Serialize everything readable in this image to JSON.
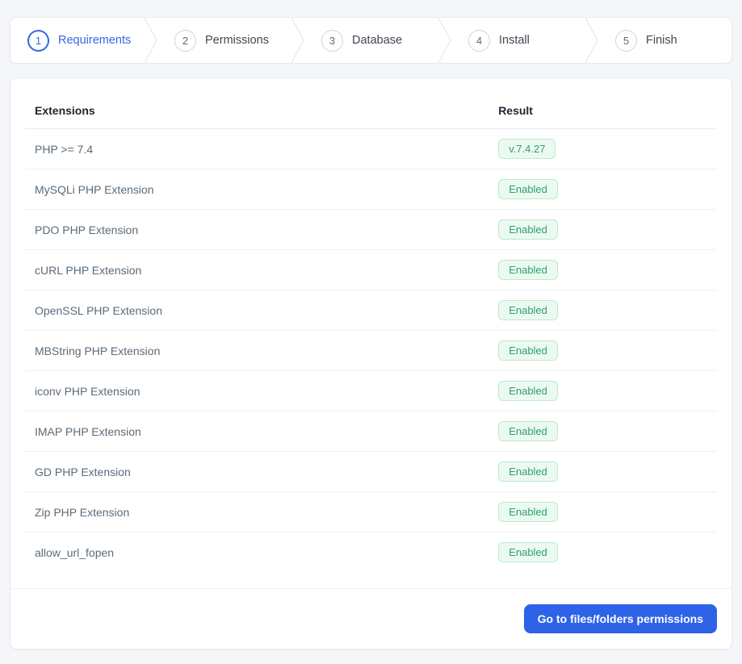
{
  "colors": {
    "accent": "#3566e3",
    "button_blue": "#2e63e8",
    "success_text": "#2f9e6e",
    "success_bg": "#eafaf1",
    "success_border": "#bfe9cd",
    "page_bg": "#f4f6f9"
  },
  "stepper": {
    "steps": [
      {
        "number": "1",
        "label": "Requirements",
        "active": true
      },
      {
        "number": "2",
        "label": "Permissions",
        "active": false
      },
      {
        "number": "3",
        "label": "Database",
        "active": false
      },
      {
        "number": "4",
        "label": "Install",
        "active": false
      },
      {
        "number": "5",
        "label": "Finish",
        "active": false
      }
    ]
  },
  "table": {
    "headers": {
      "extensions": "Extensions",
      "result": "Result"
    },
    "rows": [
      {
        "extension": "PHP >= 7.4",
        "result": "v.7.4.27"
      },
      {
        "extension": "MySQLi PHP Extension",
        "result": "Enabled"
      },
      {
        "extension": "PDO PHP Extension",
        "result": "Enabled"
      },
      {
        "extension": "cURL PHP Extension",
        "result": "Enabled"
      },
      {
        "extension": "OpenSSL PHP Extension",
        "result": "Enabled"
      },
      {
        "extension": "MBString PHP Extension",
        "result": "Enabled"
      },
      {
        "extension": "iconv PHP Extension",
        "result": "Enabled"
      },
      {
        "extension": "IMAP PHP Extension",
        "result": "Enabled"
      },
      {
        "extension": "GD PHP Extension",
        "result": "Enabled"
      },
      {
        "extension": "Zip PHP Extension",
        "result": "Enabled"
      },
      {
        "extension": "allow_url_fopen",
        "result": "Enabled"
      }
    ]
  },
  "footer": {
    "button_label": "Go to files/folders permissions"
  }
}
